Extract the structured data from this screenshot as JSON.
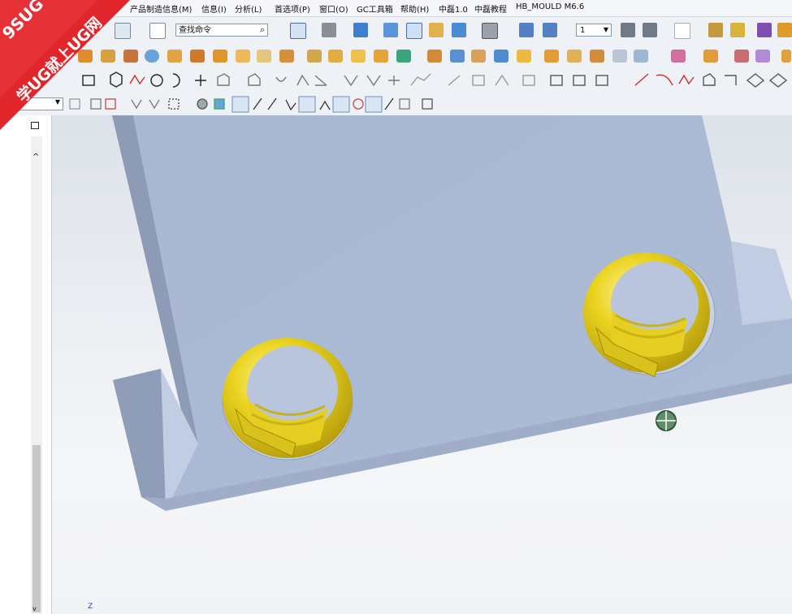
{
  "menu": {
    "items": [
      {
        "label": "产品制造信息(M)"
      },
      {
        "label": "信息(I)"
      },
      {
        "label": "分析(L)"
      },
      {
        "label": "首选项(P)"
      },
      {
        "label": "窗口(O)"
      },
      {
        "label": "GC工具箱"
      },
      {
        "label": "帮助(H)"
      },
      {
        "label": "中磊1.0"
      },
      {
        "label": "中磊教程"
      },
      {
        "label": "HB_MOULD M6.6"
      }
    ]
  },
  "toolbar": {
    "command_search_placeholder": "查找命令",
    "layer_value": "1"
  },
  "watermark": {
    "line1": "9SUG",
    "line2": "学UG就上UG网",
    "color": "#e0262b"
  },
  "viewport": {
    "axis_label": "Z",
    "part_color": "#a9b8d4",
    "insert_color": "#ead31e"
  }
}
